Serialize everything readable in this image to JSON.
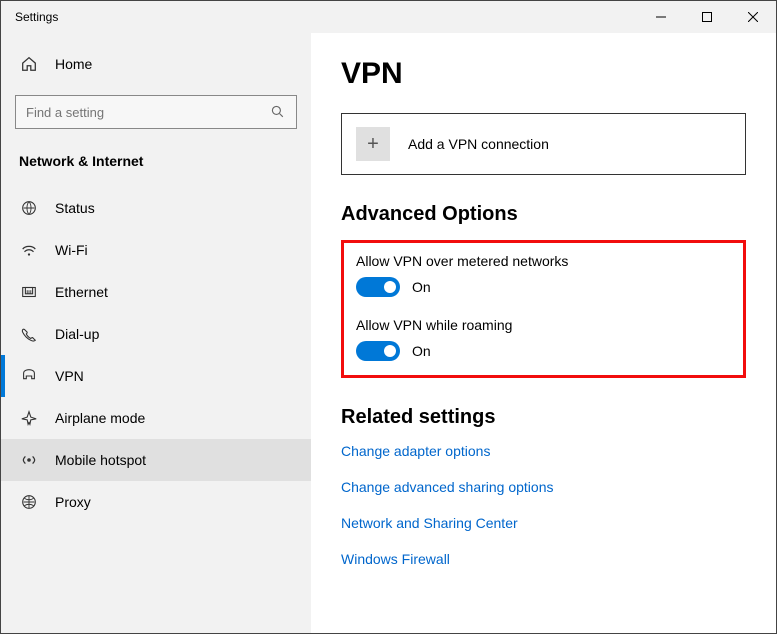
{
  "window": {
    "title": "Settings"
  },
  "sidebar": {
    "home": "Home",
    "search_placeholder": "Find a setting",
    "section": "Network & Internet",
    "items": [
      {
        "label": "Status"
      },
      {
        "label": "Wi-Fi"
      },
      {
        "label": "Ethernet"
      },
      {
        "label": "Dial-up"
      },
      {
        "label": "VPN"
      },
      {
        "label": "Airplane mode"
      },
      {
        "label": "Mobile hotspot"
      },
      {
        "label": "Proxy"
      }
    ]
  },
  "main": {
    "title": "VPN",
    "add_button": "Add a VPN connection",
    "advanced_heading": "Advanced Options",
    "opt_metered": {
      "label": "Allow VPN over metered networks",
      "state": "On"
    },
    "opt_roaming": {
      "label": "Allow VPN while roaming",
      "state": "On"
    },
    "related_heading": "Related settings",
    "links": {
      "adapter": "Change adapter options",
      "sharing": "Change advanced sharing options",
      "center": "Network and Sharing Center",
      "firewall": "Windows Firewall"
    }
  }
}
